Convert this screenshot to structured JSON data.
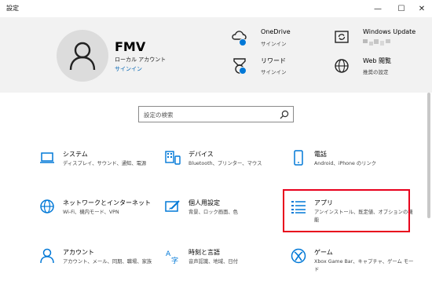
{
  "window": {
    "title": "設定",
    "minimize": "—",
    "maximize": "☐",
    "close": "✕"
  },
  "account": {
    "name": "FMV",
    "type": "ローカル アカウント",
    "signin": "サインイン"
  },
  "header_items": [
    {
      "title": "OneDrive",
      "subtitle": "サインイン",
      "icon": "onedrive-icon"
    },
    {
      "title": "リワード",
      "subtitle": "サインイン",
      "icon": "rewards-icon"
    },
    {
      "title": "Windows Update",
      "subtitle": "",
      "icon": "windows-update-icon"
    },
    {
      "title": "Web 閲覧",
      "subtitle": "推奨の設定",
      "icon": "globe-icon"
    }
  ],
  "search": {
    "placeholder": "設定の検索"
  },
  "tiles": [
    {
      "title": "システム",
      "desc": "ディスプレイ、サウンド、通知、電源",
      "icon": "laptop-icon"
    },
    {
      "title": "デバイス",
      "desc": "Bluetooth、プリンター、マウス",
      "icon": "keyboard-icon"
    },
    {
      "title": "電話",
      "desc": "Android、iPhone のリンク",
      "icon": "phone-icon"
    },
    {
      "title": "ネットワークとインターネット",
      "desc": "Wi-Fi、機内モード、VPN",
      "icon": "globe-icon"
    },
    {
      "title": "個人用設定",
      "desc": "背景、ロック画面、色",
      "icon": "personalization-icon"
    },
    {
      "title": "アプリ",
      "desc": "アンインストール、既定値、オプションの機能",
      "icon": "apps-list-icon"
    },
    {
      "title": "アカウント",
      "desc": "アカウント、メール、同期、職場、家族",
      "icon": "person-icon"
    },
    {
      "title": "時刻と言語",
      "desc": "音声認識、地域、日付",
      "icon": "time-language-icon"
    },
    {
      "title": "ゲーム",
      "desc": "Xbox Game Bar、キャプチャ、ゲーム モード",
      "icon": "xbox-icon"
    }
  ],
  "colors": {
    "accent": "#0078d7",
    "link": "#0063b1",
    "highlight_border": "#e8001c",
    "header_bg": "#f2f2f2"
  }
}
